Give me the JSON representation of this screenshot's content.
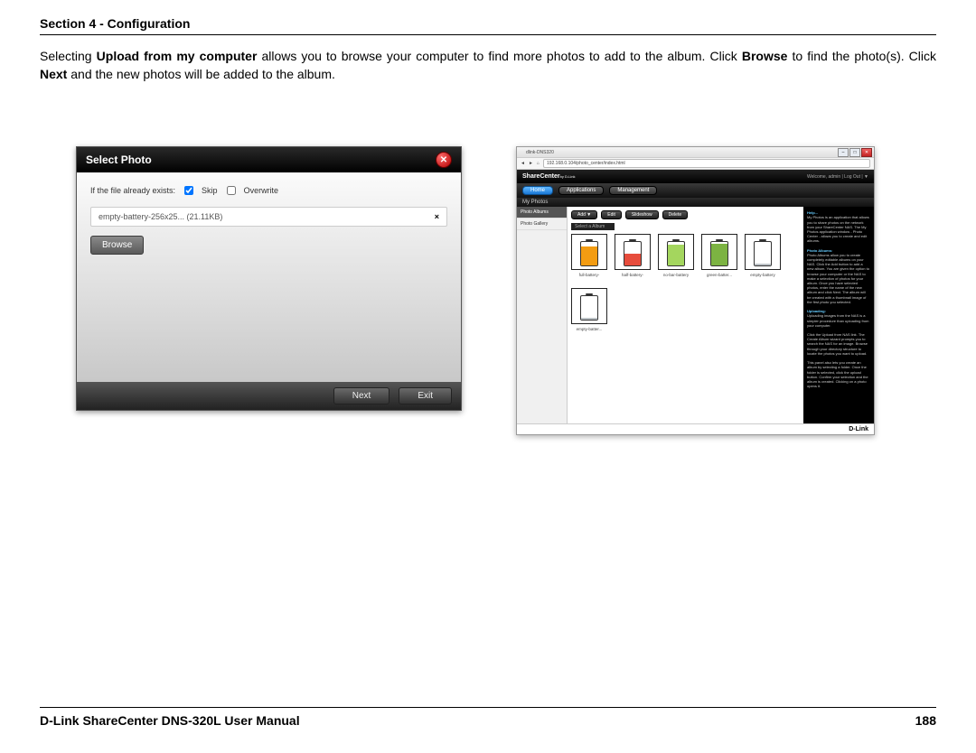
{
  "section_title": "Section 4 - Configuration",
  "body": {
    "t1": "Selecting ",
    "b1": "Upload from my computer",
    "t2": " allows you to browse your computer to find more photos to add to the album. Click ",
    "b2": "Browse",
    "t3": " to find the photo(s). Click ",
    "b3": "Next",
    "t4": " and the new photos will be added to the album."
  },
  "dialog": {
    "title": "Select Photo",
    "exists_label": "If the file already exists:",
    "skip_label": "Skip",
    "overwrite_label": "Overwrite",
    "file_name": "empty-battery-256x25... (21.11KB)",
    "file_remove": "×",
    "browse": "Browse",
    "next": "Next",
    "exit": "Exit"
  },
  "browser": {
    "tab": "dlink-DNS320",
    "url": "192.168.0.104/photo_center/index.html",
    "welcome": "Welcome, admin | Log Out | ▼",
    "brand": "ShareCenter",
    "brand_sub": "by D-Link",
    "nav": {
      "home": "Home",
      "apps": "Applications",
      "mgmt": "Management"
    },
    "subheader": "My Photos",
    "side": {
      "albums": "Photo Albums",
      "gallery": "Photo Gallery"
    },
    "toolbar": {
      "add": "Add ▼",
      "edit": "Edit",
      "slideshow": "Slideshow",
      "delete": "Delete"
    },
    "album_name": "Select a Album",
    "thumbs": [
      {
        "label": "full-battery-",
        "fill": 80,
        "color": "#f39c12"
      },
      {
        "label": "half-battery-",
        "fill": 50,
        "color": "#e74c3c"
      },
      {
        "label": "no-bar-battery",
        "fill": 90,
        "color": "#a4d65e"
      },
      {
        "label": "green-batter...",
        "fill": 95,
        "color": "#7cb342"
      },
      {
        "label": "empty-battery",
        "fill": 10,
        "color": "#bdc3c7"
      },
      {
        "label": "empty-batter...",
        "fill": 10,
        "color": "#bdc3c7"
      }
    ],
    "help_title": "Help...",
    "help_body1": "My Photos is an application that allows you to share photos on the network from your ShareCenter NAS. The My Photos application window - Photo Center - allows you to create and edit albums.",
    "help_h2": "Photo Albums:",
    "help_body2": "Photo Albums allow you to create completely editable albums on your NAS. Click the Add button to add a new album. You are given the option to browse your computer or the NAS to make a selection of photos for your album. Once you have selected photos, enter the name of the new album and click Next. The album will be created with a thumbnail image of the first photo you selected.",
    "help_h3": "Uploading:",
    "help_body3": "Uploading images from the NAS is a simpler procedure than uploading from your computer.",
    "help_body4": "Click the Upload from NAS link. The Create Album wizard prompts you to search the NAS for an image. Browse through your directory structure to locate the photos you want to upload.",
    "help_body5": "This panel also lets you create an album by selecting a folder. Once the folder is selected, click the upload button. Confirm your selection and the album is created. Clicking on a photo opens it.",
    "footer_brand": "D-Link"
  },
  "footer": {
    "product": "D-Link ShareCenter DNS-320L User Manual",
    "page": "188"
  }
}
